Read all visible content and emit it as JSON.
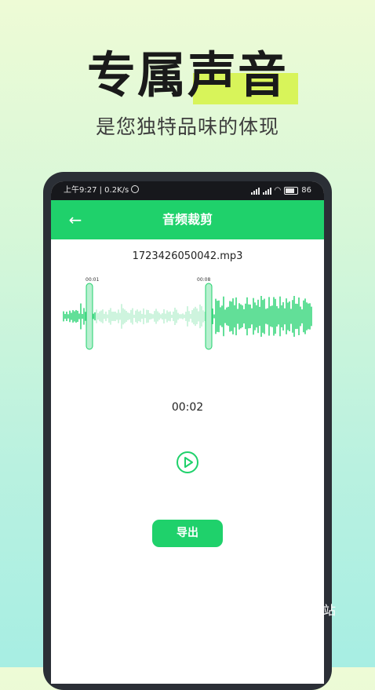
{
  "promo": {
    "title": "专属声音",
    "subtitle": "是您独特品味的体现"
  },
  "status_bar": {
    "left_text": "上午9:27 | 0.2K/s",
    "battery": "86"
  },
  "header": {
    "title": "音频裁剪",
    "back_icon": "arrow-left-icon"
  },
  "editor": {
    "file_name": "1723426050042.mp3",
    "start_marker": "00:01",
    "end_marker": "00:08",
    "current_time": "00:02",
    "play_icon": "play-circle-icon",
    "export_label": "导出"
  },
  "colors": {
    "accent": "#1fd16b",
    "waveform_light": "#b8f0d0",
    "title_highlight": "#d8f45a"
  },
  "watermark": "站"
}
